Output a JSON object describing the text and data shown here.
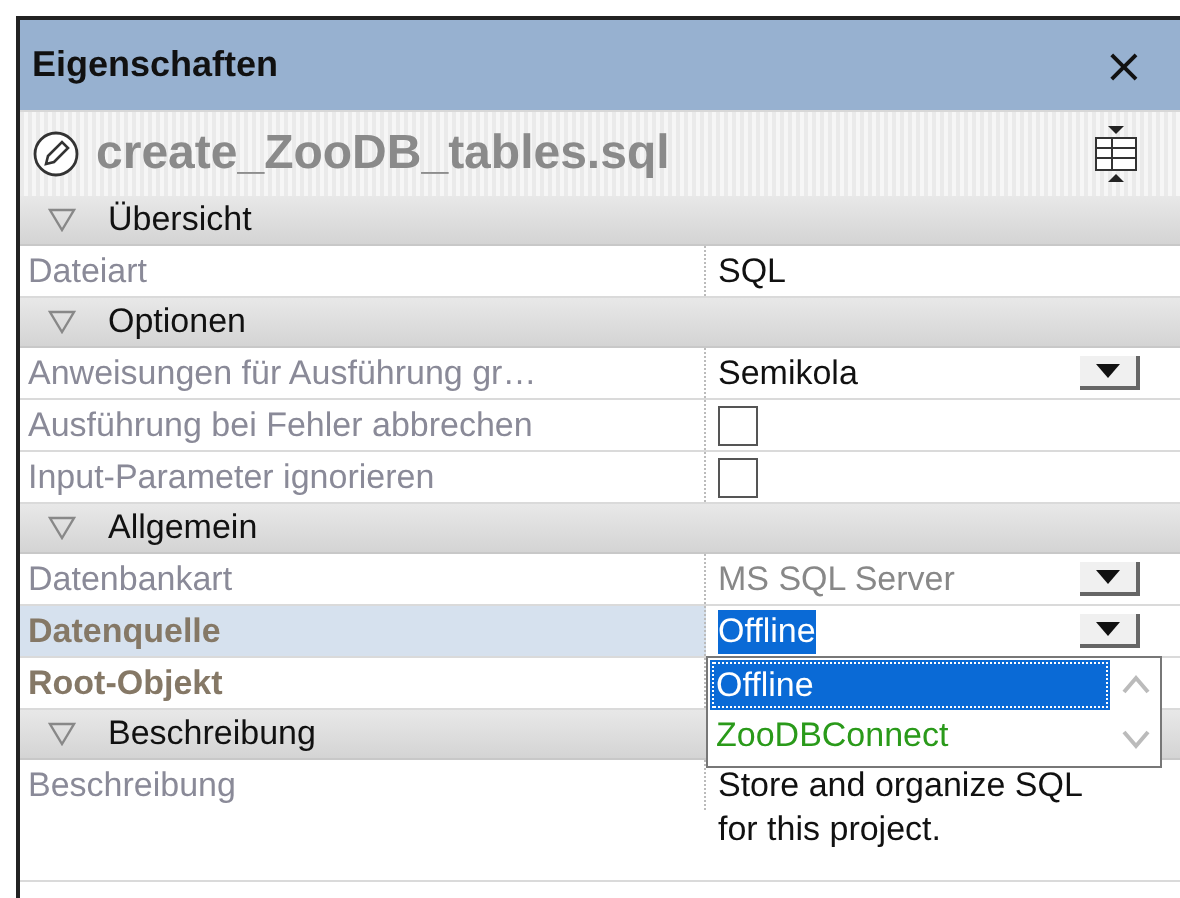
{
  "panel": {
    "title": "Eigenschaften",
    "close": "×",
    "file_name": "create_ZooDB_tables.sql"
  },
  "sections": [
    {
      "title": "Übersicht",
      "expanded": true,
      "rows": [
        {
          "kind": "text",
          "label": "Dateiart",
          "value": "SQL",
          "bold": false,
          "selected": false
        }
      ]
    },
    {
      "title": "Optionen",
      "expanded": true,
      "rows": [
        {
          "kind": "dropdown",
          "label": "Anweisungen für Ausführung gr…",
          "value": "Semikola",
          "bold": false,
          "selected": false,
          "disabled": false
        },
        {
          "kind": "checkbox",
          "label": "Ausführung bei Fehler abbrechen",
          "checked": false,
          "bold": false,
          "selected": false
        },
        {
          "kind": "checkbox",
          "label": "Input-Parameter ignorieren",
          "checked": false,
          "bold": false,
          "selected": false
        }
      ]
    },
    {
      "title": "Allgemein",
      "expanded": true,
      "rows": [
        {
          "kind": "dropdown",
          "label": "Datenbankart",
          "value": "MS SQL Server",
          "bold": false,
          "selected": false,
          "disabled": true
        },
        {
          "kind": "dropdown",
          "label": "Datenquelle",
          "value": "Offline",
          "bold": true,
          "selected": true,
          "disabled": false,
          "open": true,
          "options": [
            {
              "label": "Offline",
              "selected": true
            },
            {
              "label": "ZooDBConnect",
              "selected": false
            }
          ]
        },
        {
          "kind": "text",
          "label": "Root-Objekt",
          "bold": true,
          "selected": false
        }
      ]
    },
    {
      "title": "Beschreibung",
      "expanded": true,
      "rows": [
        {
          "kind": "multiline",
          "label": "Beschreibung",
          "value": "Store and organize SQL for this project.",
          "bold": false,
          "selected": false
        }
      ]
    }
  ]
}
